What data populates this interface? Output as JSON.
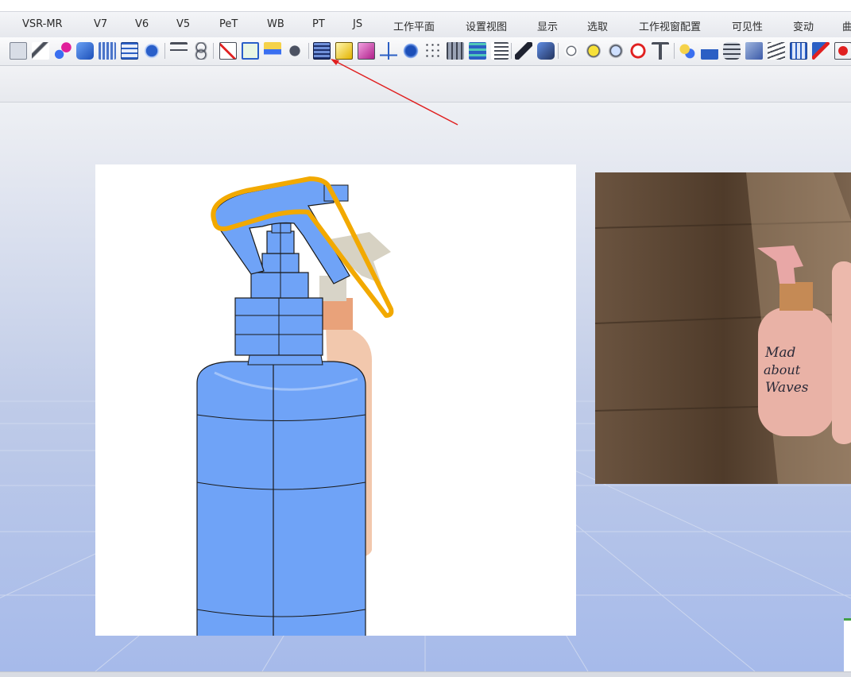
{
  "menu": {
    "tabs": [
      {
        "label": "VSR-MR"
      },
      {
        "label": "V7"
      },
      {
        "label": "V6"
      },
      {
        "label": "V5"
      },
      {
        "label": "PeT"
      },
      {
        "label": "WB"
      },
      {
        "label": "PT"
      },
      {
        "label": "JS"
      },
      {
        "label": "工作平面"
      },
      {
        "label": "设置视图"
      },
      {
        "label": "显示"
      },
      {
        "label": "选取"
      },
      {
        "label": "工作视窗配置"
      },
      {
        "label": "可见性"
      },
      {
        "label": "变动"
      },
      {
        "label": "曲"
      }
    ]
  },
  "bottle_label": {
    "line1": "Mad",
    "line2": "about",
    "line3": "Waves"
  },
  "colors": {
    "model_blue": "#6fa3f7",
    "curve_highlight": "#f2a900",
    "annotation_arrow": "#e02020",
    "wood": "#5a4432"
  },
  "icons": [
    "select-points-icon",
    "curve-icon",
    "points-icon",
    "box-icon",
    "mesh-icon",
    "grid-surface-icon",
    "sphere-grid-icon",
    "analysis-icon",
    "loop-icon",
    "slice-icon",
    "check-icon",
    "layers-icon",
    "render-icon",
    "surface-grid-icon",
    "shaded-box-icon",
    "wire-box-icon",
    "axis-icon",
    "solid-icon",
    "point-grid-icon",
    "mesh-wire-icon",
    "stack-icon",
    "list-icon",
    "tool-icon",
    "cubes-icon",
    "sphere-a-icon",
    "sphere-b-icon",
    "sphere-c-icon",
    "no-entry-icon",
    "filter-icon",
    "puzzle-icon",
    "hand-icon",
    "layers2-icon",
    "plane-icon",
    "wave-icon",
    "grid2-icon",
    "pointer-icon",
    "heart-icon"
  ]
}
